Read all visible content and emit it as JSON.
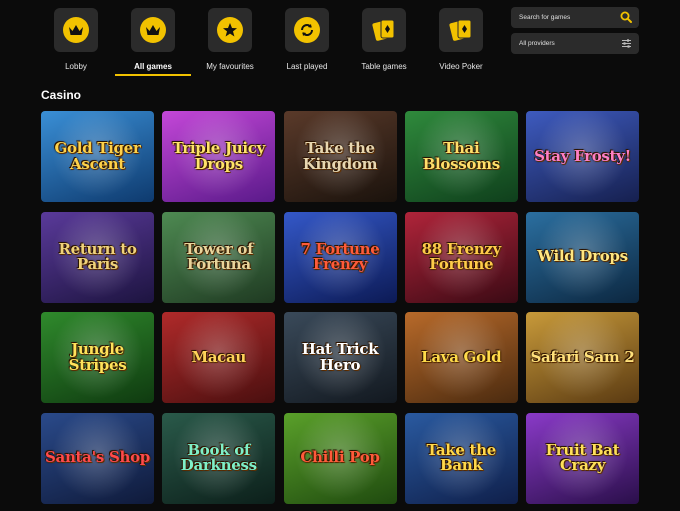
{
  "categories": [
    {
      "label": "Lobby",
      "icon": "crown-icon",
      "active": false
    },
    {
      "label": "All games",
      "icon": "crown-icon",
      "active": true
    },
    {
      "label": "My favourites",
      "icon": "star-icon",
      "active": false
    },
    {
      "label": "Last played",
      "icon": "refresh-icon",
      "active": false
    },
    {
      "label": "Table games",
      "icon": "playing-cards-icon",
      "active": false
    },
    {
      "label": "Video Poker",
      "icon": "playing-cards-icon",
      "active": false
    }
  ],
  "search": {
    "placeholder": "Search for games"
  },
  "providers": {
    "label": "All providers"
  },
  "section_title": "Casino",
  "games": [
    {
      "title": "Gold Tiger Ascent",
      "bg": "#3a8fd6",
      "bg2": "#0e3a6e",
      "text": "#ffd24a"
    },
    {
      "title": "Triple Juicy Drops",
      "bg": "#c447d8",
      "bg2": "#5a1a8a",
      "text": "#ffe36b"
    },
    {
      "title": "Take the Kingdom",
      "bg": "#5a3a2a",
      "bg2": "#1a120c",
      "text": "#e8d7b0"
    },
    {
      "title": "Thai Blossoms",
      "bg": "#2f8a3c",
      "bg2": "#0f3f1c",
      "text": "#ffdf6a"
    },
    {
      "title": "Stay Frosty!",
      "bg": "#3e5bbf",
      "bg2": "#16204f",
      "text": "#ff7fc4"
    },
    {
      "title": "Return to Paris",
      "bg": "#5a3a9a",
      "bg2": "#1d1440",
      "text": "#f0d27a"
    },
    {
      "title": "Tower of Fortuna",
      "bg": "#4e8a52",
      "bg2": "#1f3a22",
      "text": "#e9d59b"
    },
    {
      "title": "7 Fortune Frenzy",
      "bg": "#3458c8",
      "bg2": "#0c1a55",
      "text": "#ff5b3a"
    },
    {
      "title": "88 Frenzy Fortune",
      "bg": "#b0243a",
      "bg2": "#3a0a14",
      "text": "#ffcc4a"
    },
    {
      "title": "Wild Drops",
      "bg": "#2b6fa0",
      "bg2": "#0c2740",
      "text": "#ffe680"
    },
    {
      "title": "Jungle Stripes",
      "bg": "#2f8a2c",
      "bg2": "#0f3a10",
      "text": "#ffe35a"
    },
    {
      "title": "Macau",
      "bg": "#b02a2a",
      "bg2": "#4a0f0f",
      "text": "#ffd35a"
    },
    {
      "title": "Hat Trick Hero",
      "bg": "#3a4a5a",
      "bg2": "#12181f",
      "text": "#ffffff"
    },
    {
      "title": "Lava Gold",
      "bg": "#b86a2a",
      "bg2": "#4a2a0f",
      "text": "#ffdb4a"
    },
    {
      "title": "Safari Sam 2",
      "bg": "#c89a3a",
      "bg2": "#5a3a12",
      "text": "#ffe07a"
    },
    {
      "title": "Santa's Shop",
      "bg": "#2a4a8a",
      "bg2": "#0f1a3a",
      "text": "#ff4a4a"
    },
    {
      "title": "Book of Darkness",
      "bg": "#2a5a4a",
      "bg2": "#0c1f1a",
      "text": "#7ff0c8"
    },
    {
      "title": "Chilli Pop",
      "bg": "#5aa02a",
      "bg2": "#1f4a0f",
      "text": "#ff5a3a"
    },
    {
      "title": "Take the Bank",
      "bg": "#2a5aa0",
      "bg2": "#0f1f4a",
      "text": "#ffd84a"
    },
    {
      "title": "Fruit Bat Crazy",
      "bg": "#8a3ac8",
      "bg2": "#2a0f4a",
      "text": "#ffe05a"
    }
  ]
}
